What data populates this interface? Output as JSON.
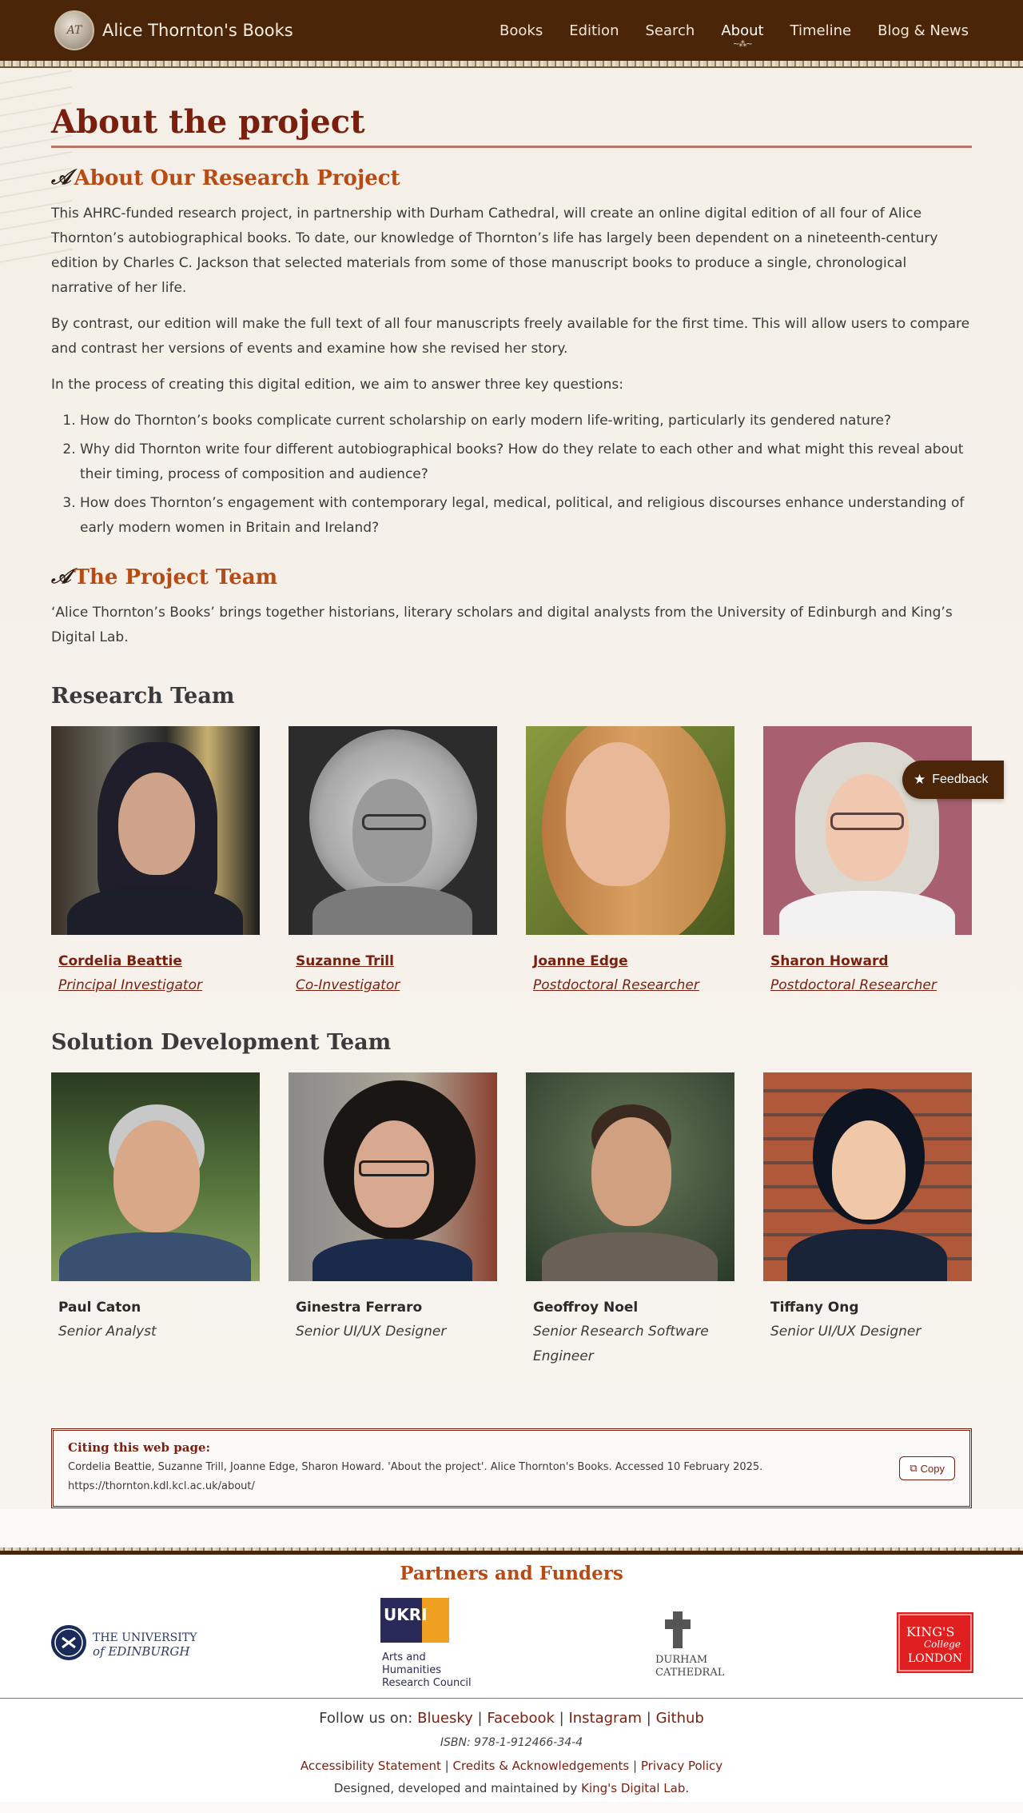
{
  "header": {
    "brand_title": "Alice Thornton's Books",
    "brand_logo_text": "AT",
    "nav": [
      {
        "label": "Books"
      },
      {
        "label": "Edition"
      },
      {
        "label": "Search"
      },
      {
        "label": "About",
        "active": true
      },
      {
        "label": "Timeline"
      },
      {
        "label": "Blog & News"
      }
    ]
  },
  "page": {
    "title": "About the project"
  },
  "research_project": {
    "heading": "About Our Research Project",
    "paragraphs": [
      "This AHRC-funded research project, in partnership with Durham Cathedral, will create an online digital edition of all four of Alice Thornton’s autobiographical books. To date, our knowledge of Thornton’s life has largely been dependent on a nineteenth-century edition by Charles C. Jackson that selected materials from some of those manuscript books to produce a single, chronological narrative of her life.",
      "By contrast, our edition will make the full text of all four manuscripts freely available for the first time. This will allow users to compare and contrast her versions of events and examine how she revised her story.",
      "In the process of creating this digital edition, we aim to answer three key questions:"
    ],
    "questions": [
      "How do Thornton’s books complicate current scholarship on early modern life-writing, particularly its gendered nature?",
      "Why did Thornton write four different autobiographical books? How do they relate to each other and what might this reveal about their timing, process of composition and audience?",
      "How does Thornton’s engagement with contemporary legal, medical, political, and religious discourses enhance understanding of early modern women in Britain and Ireland?"
    ]
  },
  "project_team": {
    "heading": "The Project Team",
    "intro": "‘Alice Thornton’s Books’ brings together historians, literary scholars and digital analysts from the University of Edinburgh and King’s Digital Lab."
  },
  "research_team": {
    "heading": "Research Team",
    "members": [
      {
        "name": "Cordelia Beattie",
        "role": "Principal Investigator"
      },
      {
        "name": "Suzanne Trill",
        "role": "Co-Investigator"
      },
      {
        "name": "Joanne Edge",
        "role": "Postdoctoral Researcher"
      },
      {
        "name": "Sharon Howard",
        "role": "Postdoctoral Researcher"
      }
    ]
  },
  "solution_team": {
    "heading": "Solution Development Team",
    "members": [
      {
        "name": "Paul Caton",
        "role": "Senior Analyst"
      },
      {
        "name": "Ginestra Ferraro",
        "role": "Senior UI/UX Designer"
      },
      {
        "name": "Geoffroy Noel",
        "role": "Senior Research Software Engineer"
      },
      {
        "name": "Tiffany Ong",
        "role": "Senior UI/UX Designer"
      }
    ]
  },
  "feedback": {
    "label": "Feedback",
    "icon": "star-icon"
  },
  "citation": {
    "title": "Citing this web page:",
    "text": "Cordelia Beattie, Suzanne Trill, Joanne Edge, Sharon Howard. 'About the project'. Alice Thornton's Books. Accessed 10 February 2025.",
    "url": "https://thornton.kdl.kcl.ac.uk/about/",
    "copy_label": "Copy"
  },
  "partners": {
    "heading": "Partners and Funders",
    "edinburgh": {
      "line1": "THE UNIVERSITY",
      "line2": "of EDINBURGH"
    },
    "ukri": {
      "mark": "UKRI",
      "line1": "Arts and",
      "line2": "Humanities",
      "line3": "Research Council"
    },
    "durham": {
      "line1": "DURHAM",
      "line2": "CATHEDRAL"
    },
    "kings": {
      "line1": "KING'S",
      "line2": "College",
      "line3": "LONDON"
    }
  },
  "footer": {
    "follow_label": "Follow us on:",
    "social": [
      "Bluesky",
      "Facebook",
      "Instagram",
      "Github"
    ],
    "separator": "|",
    "isbn": "ISBN: 978-1-912466-34-4",
    "legal": [
      "Accessibility Statement",
      "Credits & Acknowledgements",
      "Privacy Policy"
    ],
    "credit_prefix": "Designed, developed and maintained by",
    "credit_link": "King's Digital Lab",
    "credit_suffix": "."
  },
  "colors": {
    "header_bg": "#4a2508",
    "title": "#7a1f0e",
    "section_heading": "#b84a14"
  }
}
